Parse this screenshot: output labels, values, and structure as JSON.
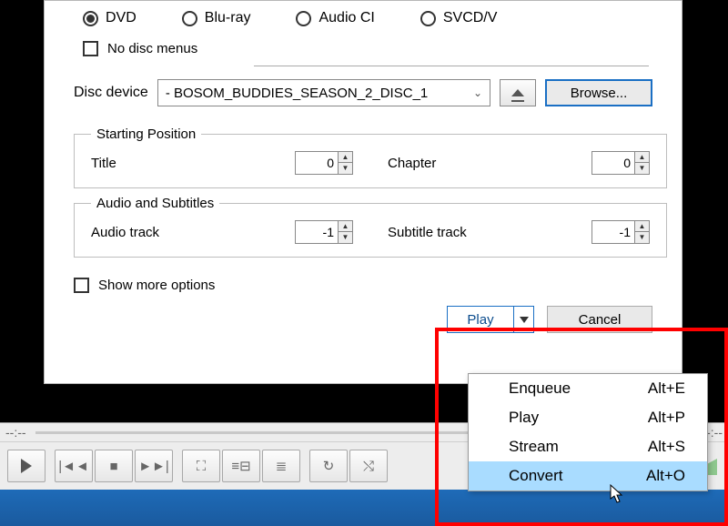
{
  "disc_types": {
    "dvd": "DVD",
    "bluray": "Blu-ray",
    "audio": "Audio CI",
    "svcd": "SVCD/V"
  },
  "no_menus_label": "No disc menus",
  "device_label": "Disc device",
  "device_value": "- BOSOM_BUDDIES_SEASON_2_DISC_1",
  "browse_label": "Browse...",
  "start_pos": {
    "legend": "Starting Position",
    "title_label": "Title",
    "title_value": "0",
    "chapter_label": "Chapter",
    "chapter_value": "0"
  },
  "audio_sub": {
    "legend": "Audio and Subtitles",
    "audio_label": "Audio track",
    "audio_value": "-1",
    "sub_label": "Subtitle track",
    "sub_value": "-1"
  },
  "show_more_label": "Show more options",
  "play_btn_label": "Play",
  "cancel_btn_label": "Cancel",
  "menu": [
    {
      "label": "Enqueue",
      "accel": "Alt+E"
    },
    {
      "label": "Play",
      "accel": "Alt+P"
    },
    {
      "label": "Stream",
      "accel": "Alt+S"
    },
    {
      "label": "Convert",
      "accel": "Alt+O"
    }
  ],
  "time_left": "--:--",
  "time_right": "--:--"
}
